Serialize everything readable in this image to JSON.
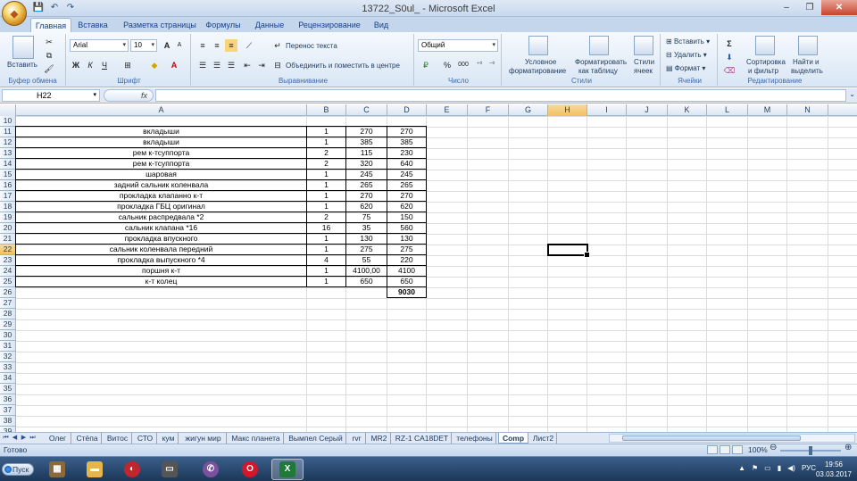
{
  "window": {
    "title": "13722_S0ul_ - Microsoft Excel"
  },
  "quick_access": {
    "save": "💾",
    "undo": "↶",
    "redo": "↷"
  },
  "ribbon_tabs": [
    "Главная",
    "Вставка",
    "Разметка страницы",
    "Формулы",
    "Данные",
    "Рецензирование",
    "Вид"
  ],
  "ribbon": {
    "clipboard": {
      "label": "Буфер обмена",
      "paste": "Вставить"
    },
    "font": {
      "label": "Шрифт",
      "name": "Arial",
      "size": "10",
      "bold": "Ж",
      "italic": "К",
      "underline": "Ч"
    },
    "alignment": {
      "label": "Выравнивание",
      "wrap_text": "Перенос текста",
      "merge": "Объединить и поместить в центре"
    },
    "number": {
      "label": "Число",
      "format": "Общий",
      "percent": "%",
      "comma": "000"
    },
    "styles": {
      "label": "Стили",
      "cond_format_1": "Условное",
      "cond_format_2": "форматирование",
      "table_format_1": "Форматировать",
      "table_format_2": "как таблицу",
      "cell_styles_1": "Стили",
      "cell_styles_2": "ячеек"
    },
    "cells": {
      "label": "Ячейки",
      "insert": "Вставить",
      "delete": "Удалить",
      "format": "Формат"
    },
    "editing": {
      "label": "Редактирование",
      "sort_1": "Сортировка",
      "sort_2": "и фильтр",
      "find_1": "Найти и",
      "find_2": "выделить"
    }
  },
  "formula_bar": {
    "name_box": "H22",
    "fx": "fx",
    "content": ""
  },
  "columns": [
    "A",
    "B",
    "C",
    "D",
    "E",
    "F",
    "G",
    "H",
    "I",
    "J",
    "K",
    "L",
    "M",
    "N"
  ],
  "selected_column": "H",
  "rows": [
    "10",
    "11",
    "12",
    "13",
    "14",
    "15",
    "16",
    "17",
    "18",
    "19",
    "20",
    "21",
    "22",
    "23",
    "24",
    "25",
    "26",
    "27",
    "28",
    "29",
    "30",
    "31",
    "32",
    "33",
    "34",
    "35",
    "36",
    "37",
    "38",
    "39"
  ],
  "selected_row": "22",
  "table": [
    {
      "row": "11",
      "a": "вкладыши",
      "b": "1",
      "c": "270",
      "d": "270"
    },
    {
      "row": "12",
      "a": "вкладыши",
      "b": "1",
      "c": "385",
      "d": "385"
    },
    {
      "row": "13",
      "a": "рем к-тсуппорта",
      "b": "2",
      "c": "115",
      "d": "230"
    },
    {
      "row": "14",
      "a": "рем к-тсуппорта",
      "b": "2",
      "c": "320",
      "d": "640"
    },
    {
      "row": "15",
      "a": "шаровая",
      "b": "1",
      "c": "245",
      "d": "245"
    },
    {
      "row": "16",
      "a": "задний сальник коленвала",
      "b": "1",
      "c": "265",
      "d": "265"
    },
    {
      "row": "17",
      "a": "прокладка клапанно к-т",
      "b": "1",
      "c": "270",
      "d": "270"
    },
    {
      "row": "18",
      "a": "прокладка ГБЦ оригинал",
      "b": "1",
      "c": "620",
      "d": "620"
    },
    {
      "row": "19",
      "a": "сальник распредвала *2",
      "b": "2",
      "c": "75",
      "d": "150"
    },
    {
      "row": "20",
      "a": "сальник клапана *16",
      "b": "16",
      "c": "35",
      "d": "560"
    },
    {
      "row": "21",
      "a": "прокладка впускного",
      "b": "1",
      "c": "130",
      "d": "130"
    },
    {
      "row": "22",
      "a": "сальник коленвала передний",
      "b": "1",
      "c": "275",
      "d": "275"
    },
    {
      "row": "23",
      "a": "прокладка выпускного *4",
      "b": "4",
      "c": "55",
      "d": "220"
    },
    {
      "row": "24",
      "a": "поршня к-т",
      "b": "1",
      "c": "4100,00",
      "d": "4100"
    },
    {
      "row": "25",
      "a": "к-т колец",
      "b": "1",
      "c": "650",
      "d": "650"
    }
  ],
  "total": {
    "row": "26",
    "value": "9030"
  },
  "sheet_tabs": [
    "Олег",
    "Стёпа",
    "Витос",
    "СТО",
    "кум",
    "жигун мир",
    "Макс планета",
    "Вымпел Серый",
    "rvr",
    "MR2",
    "RZ-1  CA18DET",
    "телефоны",
    "Comp",
    "Лист2"
  ],
  "active_sheet": "Comp",
  "status": {
    "text": "Готово",
    "zoom": "100%"
  },
  "taskbar": {
    "start": "Пуск",
    "lang": "РУС",
    "time": "19:56",
    "date": "03.03.2017"
  }
}
